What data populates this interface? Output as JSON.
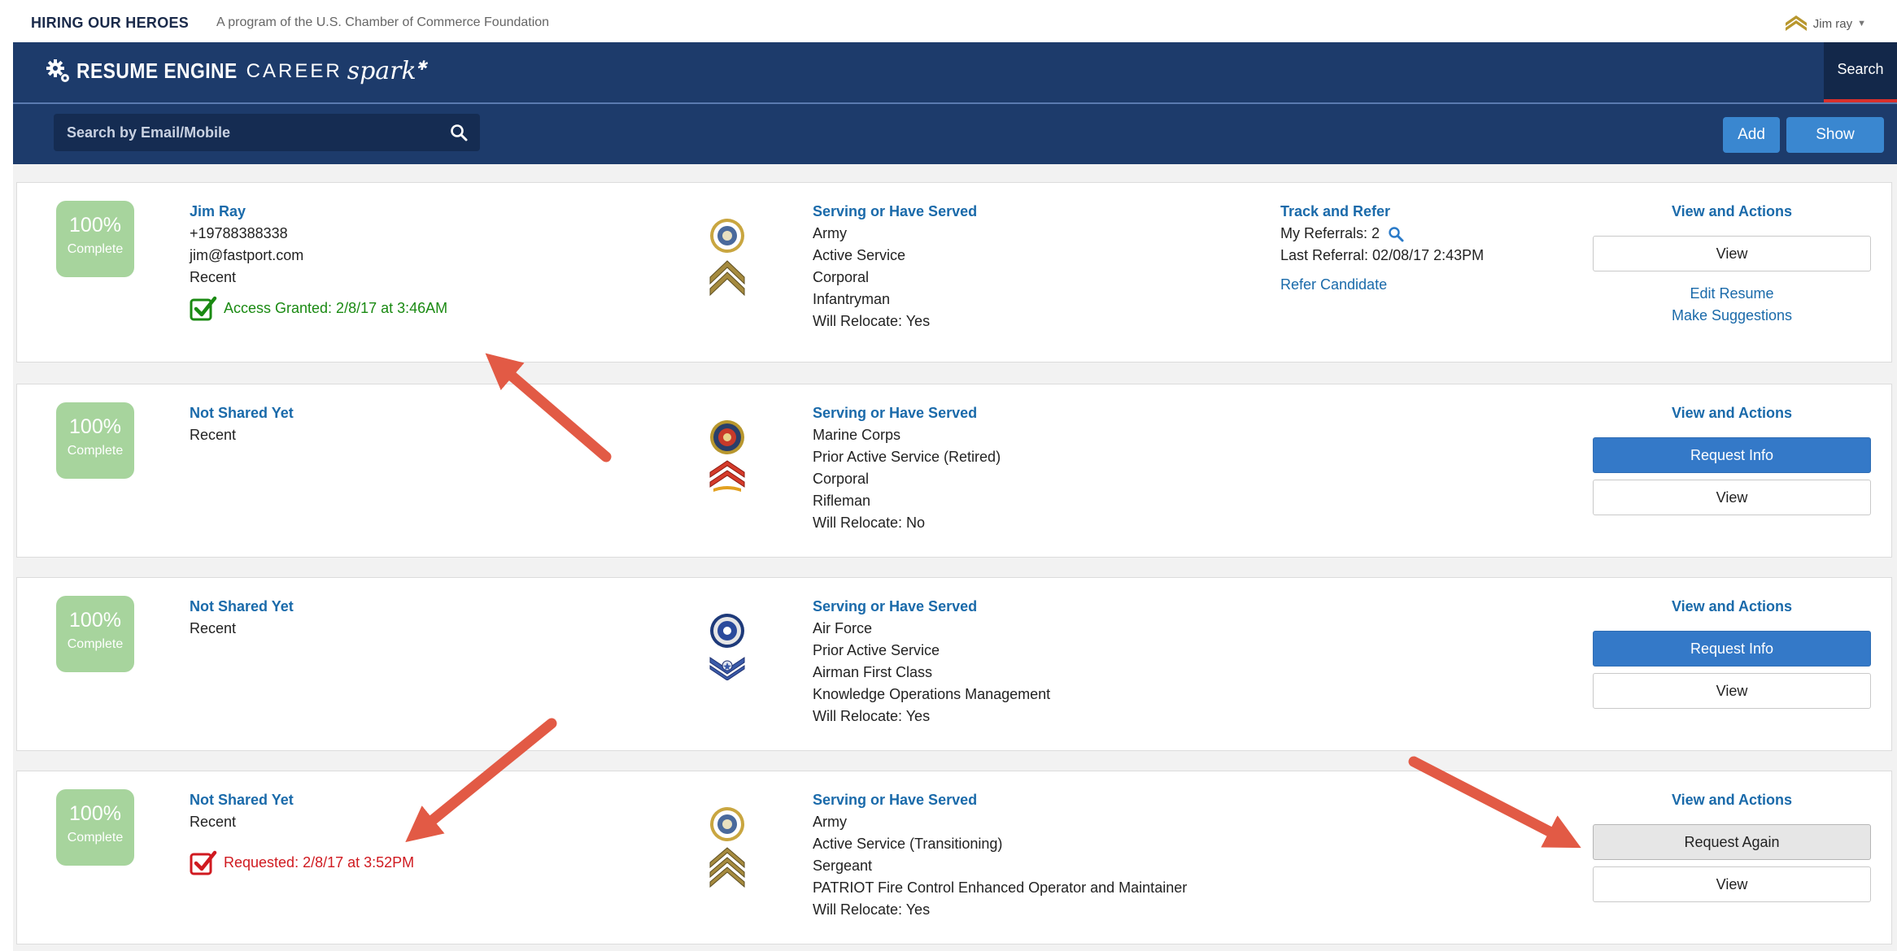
{
  "top": {
    "logo": "HIRING OUR HEROES",
    "tagline": "A program of the U.S. Chamber of Commerce Foundation",
    "user": "Jim ray"
  },
  "brand": {
    "engine": "RESUME ENGINE",
    "career": "CAREER",
    "spark": "spark"
  },
  "nav": {
    "search_tab": "Search"
  },
  "searchbar": {
    "placeholder": "Search by Email/Mobile",
    "add_label": "Add",
    "show_label": "Show"
  },
  "colors": {
    "navy": "#1d3b6b",
    "accent_blue": "#3479c8",
    "link_blue": "#1a6aaa",
    "badge_green": "#a7d49d",
    "granted_green": "#1a8a12",
    "requested_red": "#d01a20",
    "arrow_red": "#e25a45"
  },
  "cards": [
    {
      "badge": {
        "pct": "100%",
        "label": "Complete"
      },
      "name": "Jim Ray",
      "details": [
        "+19788388338",
        "jim@fastport.com",
        "Recent"
      ],
      "status": {
        "text": "Access Granted: 2/8/17 at 3:46AM",
        "type": "granted",
        "icon": "green-checkbox-icon"
      },
      "service": {
        "head": "Serving or Have Served",
        "lines": [
          "Army",
          "Active Service",
          "Corporal",
          "Infantryman",
          "Will Relocate: Yes"
        ]
      },
      "emblems": [
        "army-seal-icon",
        "corporal-chevron-icon"
      ],
      "track": {
        "head": "Track and Refer",
        "referrals": "My Referrals: 2",
        "last": "Last Referral: 02/08/17 2:43PM",
        "refer": "Refer Candidate"
      },
      "actions": {
        "head": "View and Actions",
        "view": "View",
        "edit": "Edit Resume",
        "suggest": "Make Suggestions"
      }
    },
    {
      "badge": {
        "pct": "100%",
        "label": "Complete"
      },
      "name": "Not Shared Yet",
      "details": [
        "Recent"
      ],
      "service": {
        "head": "Serving or Have Served",
        "lines": [
          "Marine Corps",
          "Prior Active Service (Retired)",
          "Corporal",
          "Rifleman",
          "Will Relocate: No"
        ]
      },
      "emblems": [
        "marine-corps-seal-icon",
        "marine-corporal-chevron-icon"
      ],
      "actions": {
        "head": "View and Actions",
        "request": "Request Info",
        "view": "View"
      }
    },
    {
      "badge": {
        "pct": "100%",
        "label": "Complete"
      },
      "name": "Not Shared Yet",
      "details": [
        "Recent"
      ],
      "service": {
        "head": "Serving or Have Served",
        "lines": [
          "Air Force",
          "Prior Active Service",
          "Airman First Class",
          "Knowledge Operations Management",
          "Will Relocate: Yes"
        ]
      },
      "emblems": [
        "air-force-seal-icon",
        "airman-stripes-icon"
      ],
      "actions": {
        "head": "View and Actions",
        "request": "Request Info",
        "view": "View"
      }
    },
    {
      "badge": {
        "pct": "100%",
        "label": "Complete"
      },
      "name": "Not Shared Yet",
      "details": [
        "Recent"
      ],
      "status": {
        "text": "Requested: 2/8/17 at 3:52PM",
        "type": "requested",
        "icon": "red-checkbox-icon"
      },
      "service": {
        "head": "Serving or Have Served",
        "lines": [
          "Army",
          "Active Service (Transitioning)",
          "Sergeant",
          "PATRIOT Fire Control Enhanced Operator and Maintainer",
          "Will Relocate: Yes"
        ]
      },
      "emblems": [
        "army-seal-icon",
        "sergeant-chevron-icon"
      ],
      "actions": {
        "head": "View and Actions",
        "request_again": "Request Again",
        "view": "View"
      }
    }
  ]
}
